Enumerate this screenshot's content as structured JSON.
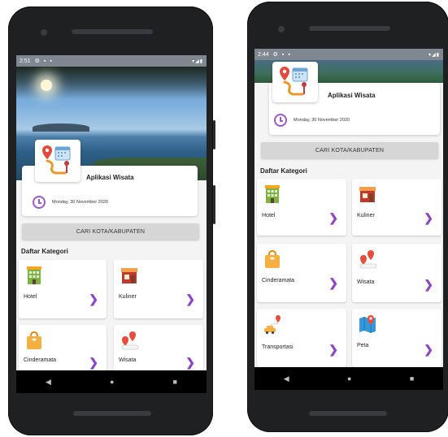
{
  "phone_left": {
    "status": {
      "time": "2:51",
      "icons": "▾◢▮"
    },
    "app_title": "Aplikasi Wisata",
    "date": "Monday, 30 November 2020",
    "city_button": "CARI KOTA/KABUPATEN",
    "section_title": "Daftar Kategori",
    "categories": [
      {
        "label": "Hotel",
        "icon": "hotel-icon"
      },
      {
        "label": "Kuliner",
        "icon": "restaurant-icon"
      },
      {
        "label": "Cinderamata",
        "icon": "souvenir-bag-icon"
      },
      {
        "label": "Wisata",
        "icon": "map-pin-route-icon"
      }
    ]
  },
  "phone_right": {
    "status": {
      "time": "2:44",
      "icons": "▾◢▮"
    },
    "app_title": "Aplikasi Wisata",
    "date": "Monday, 30 November 2020",
    "city_button": "CARI KOTA/KABUPATEN",
    "section_title": "Daftar Kategori",
    "categories": [
      {
        "label": "Hotel",
        "icon": "hotel-icon"
      },
      {
        "label": "Kuliner",
        "icon": "restaurant-icon"
      },
      {
        "label": "Cinderamata",
        "icon": "souvenir-bag-icon"
      },
      {
        "label": "Wisata",
        "icon": "map-pin-route-icon"
      },
      {
        "label": "Transportasi",
        "icon": "car-route-icon"
      },
      {
        "label": "Peta",
        "icon": "map-icon"
      }
    ]
  },
  "colors": {
    "accent": "#8e44c4",
    "button_bg": "#d6d6d6"
  }
}
